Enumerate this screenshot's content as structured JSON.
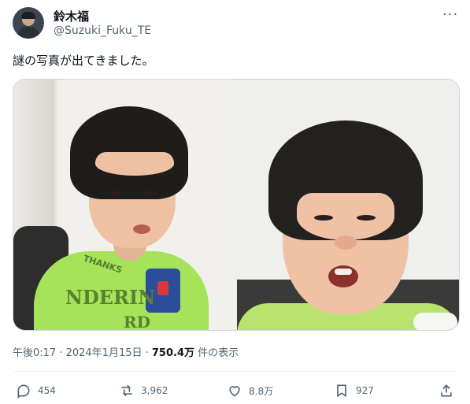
{
  "user": {
    "display_name": "鈴木福",
    "handle": "@Suzuki_Fuku_TE"
  },
  "more_label": "···",
  "tweet": {
    "text": "謎の写真が出てきました。"
  },
  "media": {
    "photo_count": 2,
    "shirt_text_1": "THANKS",
    "shirt_text_2": "NDERIN",
    "shirt_text_3": "RD"
  },
  "meta": {
    "timestamp": "午後0:17 · 2024年1月15日 · ",
    "views_count": "750.4万",
    "views_label": " 件の表示"
  },
  "actions": {
    "replies": "454",
    "reposts": "3,962",
    "likes": "8.8万",
    "bookmarks": "927"
  },
  "colors": {
    "text": "#0f1419",
    "secondary": "#536471",
    "divider": "#eff3f4",
    "border": "#cfd9de"
  },
  "icons": [
    "reply-icon",
    "repost-icon",
    "like-icon",
    "bookmark-icon",
    "share-icon",
    "more-icon"
  ]
}
